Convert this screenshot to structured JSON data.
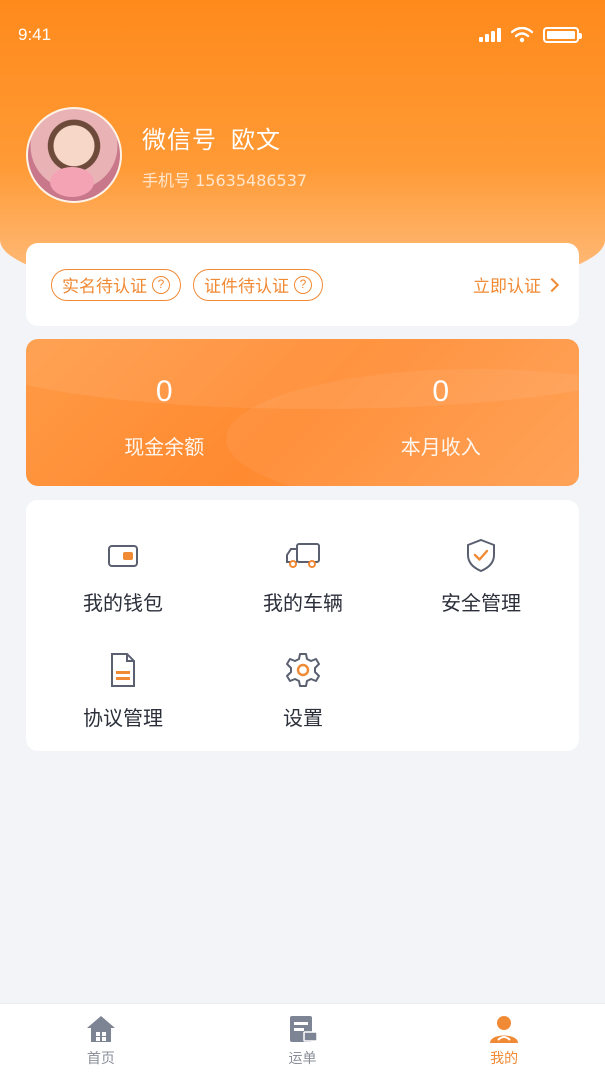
{
  "status_bar": {
    "time": "9:41"
  },
  "profile": {
    "nickname_label": "微信号",
    "nickname": "欧文",
    "phone_label": "手机号",
    "phone": "15635486537"
  },
  "verify": {
    "tags": [
      {
        "label": "实名待认证"
      },
      {
        "label": "证件待认证"
      }
    ],
    "link_label": "立即认证"
  },
  "balance": {
    "cash_value": "0",
    "cash_label": "现金余额",
    "income_value": "0",
    "income_label": "本月收入"
  },
  "menu": {
    "items": [
      {
        "label": "我的钱包",
        "icon": "wallet-icon"
      },
      {
        "label": "我的车辆",
        "icon": "truck-icon"
      },
      {
        "label": "安全管理",
        "icon": "shield-icon"
      },
      {
        "label": "协议管理",
        "icon": "document-icon"
      },
      {
        "label": "设置",
        "icon": "gear-icon"
      }
    ]
  },
  "tabbar": {
    "items": [
      {
        "label": "首页",
        "icon": "home-icon",
        "active": false
      },
      {
        "label": "运单",
        "icon": "waybill-icon",
        "active": false
      },
      {
        "label": "我的",
        "icon": "user-icon",
        "active": true
      }
    ]
  },
  "colors": {
    "accent": "#f08a35",
    "header": "#ff8a1c"
  }
}
